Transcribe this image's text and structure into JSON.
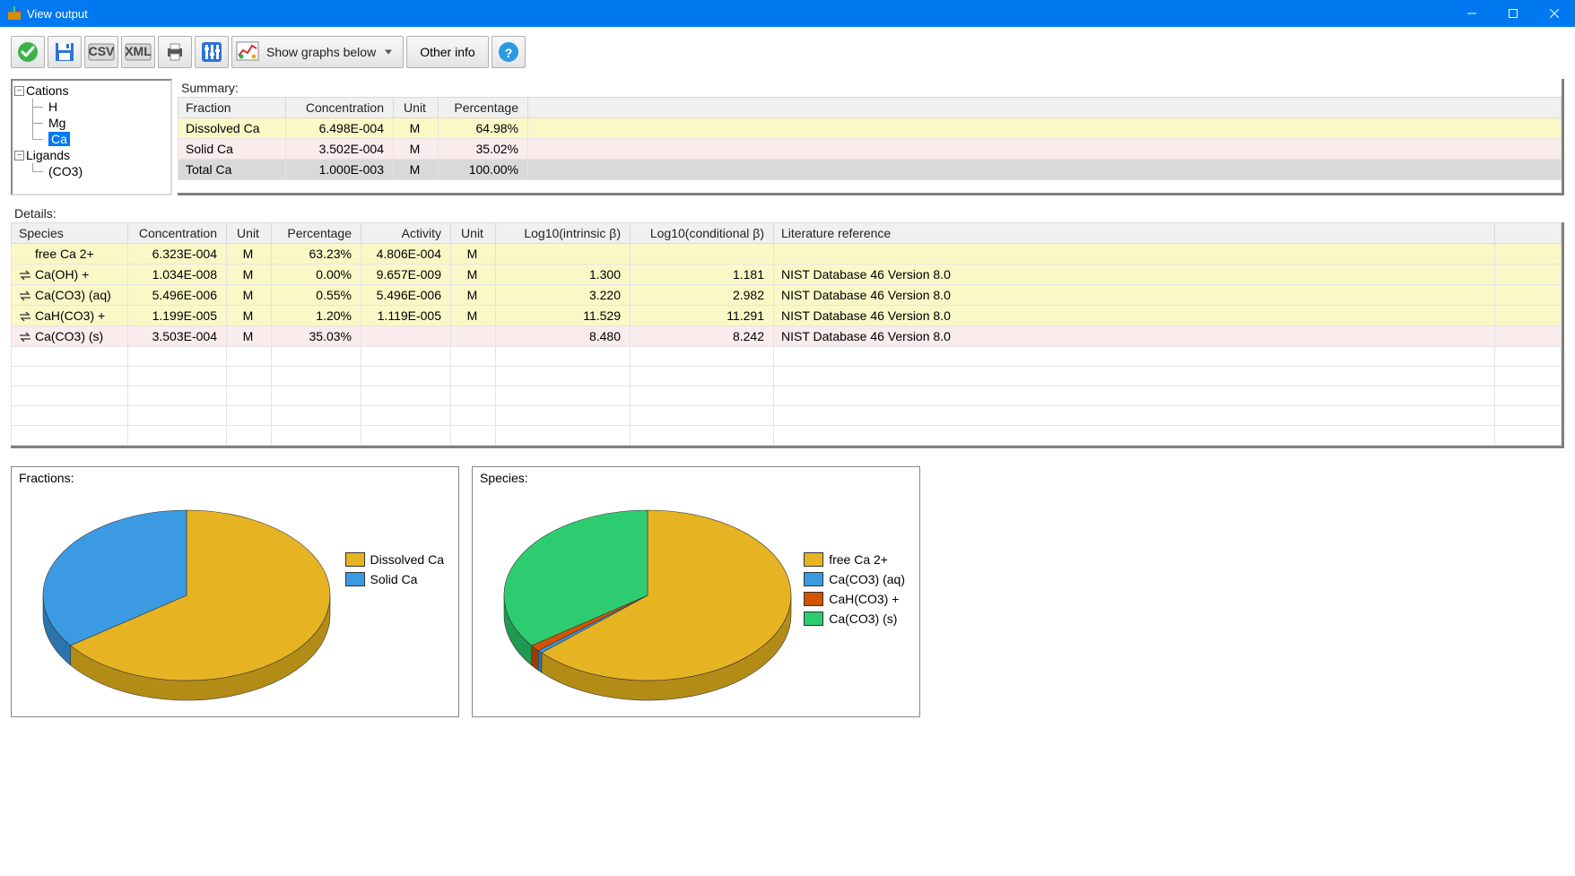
{
  "window": {
    "title": "View output"
  },
  "toolbar": {
    "graph_select_value": "Show graphs below",
    "other_info": "Other info"
  },
  "tree": {
    "cations": {
      "label": "Cations",
      "items": [
        "H",
        "Mg",
        "Ca"
      ],
      "selected": "Ca"
    },
    "ligands": {
      "label": "Ligands",
      "items": [
        "(CO3)"
      ]
    }
  },
  "summary": {
    "title": "Summary:",
    "headers": [
      "Fraction",
      "Concentration",
      "Unit",
      "Percentage"
    ],
    "rows": [
      {
        "fraction": "Dissolved Ca",
        "conc": "6.498E-004",
        "unit": "M",
        "pct": "64.98%",
        "class": "row-yellow"
      },
      {
        "fraction": "Solid Ca",
        "conc": "3.502E-004",
        "unit": "M",
        "pct": "35.02%",
        "class": "row-pink"
      },
      {
        "fraction": "Total Ca",
        "conc": "1.000E-003",
        "unit": "M",
        "pct": "100.00%",
        "class": "row-grey"
      }
    ]
  },
  "details": {
    "title": "Details:",
    "headers": [
      "Species",
      "Concentration",
      "Unit",
      "Percentage",
      "Activity",
      "Unit",
      "Log10(intrinsic β)",
      "Log10(conditional β)",
      "Literature reference"
    ],
    "rows": [
      {
        "eq": false,
        "species": "free Ca 2+",
        "conc": "6.323E-004",
        "unit": "M",
        "pct": "63.23%",
        "act": "4.806E-004",
        "unit2": "M",
        "lib": "",
        "lcb": "",
        "ref": "",
        "class": "row-yellow"
      },
      {
        "eq": true,
        "species": "Ca(OH) +",
        "conc": "1.034E-008",
        "unit": "M",
        "pct": "0.00%",
        "act": "9.657E-009",
        "unit2": "M",
        "lib": "1.300",
        "lcb": "1.181",
        "ref": "NIST Database 46 Version 8.0",
        "class": "row-yellow"
      },
      {
        "eq": true,
        "species": "Ca(CO3) (aq)",
        "conc": "5.496E-006",
        "unit": "M",
        "pct": "0.55%",
        "act": "5.496E-006",
        "unit2": "M",
        "lib": "3.220",
        "lcb": "2.982",
        "ref": "NIST Database 46 Version 8.0",
        "class": "row-yellow"
      },
      {
        "eq": true,
        "species": "CaH(CO3) +",
        "conc": "1.199E-005",
        "unit": "M",
        "pct": "1.20%",
        "act": "1.119E-005",
        "unit2": "M",
        "lib": "11.529",
        "lcb": "11.291",
        "ref": "NIST Database 46 Version 8.0",
        "class": "row-yellow"
      },
      {
        "eq": true,
        "species": "Ca(CO3) (s)",
        "conc": "3.503E-004",
        "unit": "M",
        "pct": "35.03%",
        "act": "",
        "unit2": "",
        "lib": "8.480",
        "lcb": "8.242",
        "ref": "NIST Database 46 Version 8.0",
        "class": "row-pink"
      }
    ]
  },
  "charts": {
    "fractions": {
      "title": "Fractions:",
      "legend": [
        "Dissolved Ca",
        "Solid Ca"
      ]
    },
    "species": {
      "title": "Species:",
      "legend": [
        "free Ca 2+",
        "Ca(CO3) (aq)",
        "CaH(CO3) +",
        "Ca(CO3) (s)"
      ]
    }
  },
  "chart_data": [
    {
      "type": "pie",
      "title": "Fractions",
      "series": [
        {
          "name": "Dissolved Ca",
          "value": 64.98
        },
        {
          "name": "Solid Ca",
          "value": 35.02
        }
      ]
    },
    {
      "type": "pie",
      "title": "Species",
      "series": [
        {
          "name": "free Ca 2+",
          "value": 63.23
        },
        {
          "name": "Ca(CO3) (aq)",
          "value": 0.55
        },
        {
          "name": "CaH(CO3) +",
          "value": 1.2
        },
        {
          "name": "Ca(CO3) (s)",
          "value": 35.03
        }
      ]
    }
  ]
}
